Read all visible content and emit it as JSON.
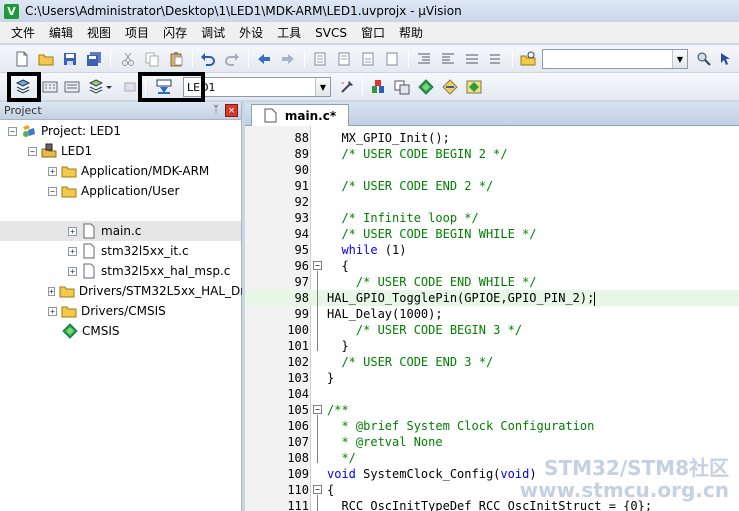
{
  "window": {
    "title": "C:\\Users\\Administrator\\Desktop\\1\\LED1\\MDK-ARM\\LED1.uvprojx - µVision",
    "app_icon": "V"
  },
  "menu": [
    "文件",
    "编辑",
    "视图",
    "项目",
    "闪存",
    "调试",
    "外设",
    "工具",
    "SVCS",
    "窗口",
    "帮助"
  ],
  "toolbar2": {
    "target_combo": "LED1",
    "load_label": "LOAD"
  },
  "project_panel": {
    "title": "Project",
    "pin": "ᛘ",
    "close": "×",
    "tree": [
      {
        "label": "Project: LED1",
        "expander": "−",
        "icon": "project-icon"
      },
      {
        "label": "LED1",
        "expander": "−",
        "icon": "target-icon"
      },
      {
        "label": "Application/MDK-ARM",
        "expander": "+",
        "icon": "folder-icon"
      },
      {
        "label": "Application/User",
        "expander": "−",
        "icon": "folder-icon"
      },
      {
        "label": "main.c",
        "expander": "+",
        "icon": "file-icon"
      },
      {
        "label": "stm32l5xx_it.c",
        "expander": "+",
        "icon": "file-icon"
      },
      {
        "label": "stm32l5xx_hal_msp.c",
        "expander": "+",
        "icon": "file-icon"
      },
      {
        "label": "Drivers/STM32L5xx_HAL_Driver",
        "expander": "+",
        "icon": "folder-icon"
      },
      {
        "label": "Drivers/CMSIS",
        "expander": "+",
        "icon": "folder-icon"
      },
      {
        "label": "CMSIS",
        "expander": "",
        "icon": "cmsis-icon"
      }
    ]
  },
  "editor": {
    "tab_label": "main.c*",
    "lines": [
      {
        "n": "88",
        "parts": [
          [
            "",
            "  MX_GPIO_Init();"
          ]
        ]
      },
      {
        "n": "89",
        "parts": [
          [
            "cm",
            "  /* USER CODE BEGIN 2 */"
          ]
        ]
      },
      {
        "n": "90",
        "parts": [
          [
            "",
            ""
          ]
        ]
      },
      {
        "n": "91",
        "parts": [
          [
            "cm",
            "  /* USER CODE END 2 */"
          ]
        ]
      },
      {
        "n": "92",
        "parts": [
          [
            "",
            ""
          ]
        ]
      },
      {
        "n": "93",
        "parts": [
          [
            "cm",
            "  /* Infinite loop */"
          ]
        ]
      },
      {
        "n": "94",
        "parts": [
          [
            "cm",
            "  /* USER CODE BEGIN WHILE */"
          ]
        ]
      },
      {
        "n": "95",
        "parts": [
          [
            "kw",
            "  while"
          ],
          [
            "",
            " (1)"
          ]
        ]
      },
      {
        "n": "96",
        "parts": [
          [
            "",
            "  {"
          ]
        ],
        "fold": "−"
      },
      {
        "n": "97",
        "parts": [
          [
            "cm",
            "    /* USER CODE END WHILE */"
          ]
        ]
      },
      {
        "n": "98",
        "parts": [
          [
            "",
            "HAL_GPIO_TogglePin(GPIOE,GPIO_PIN_2);"
          ]
        ],
        "current": true
      },
      {
        "n": "99",
        "parts": [
          [
            "",
            "HAL_Delay(1000);"
          ]
        ]
      },
      {
        "n": "100",
        "parts": [
          [
            "cm",
            "    /* USER CODE BEGIN 3 */"
          ]
        ]
      },
      {
        "n": "101",
        "parts": [
          [
            "",
            "  }"
          ]
        ]
      },
      {
        "n": "102",
        "parts": [
          [
            "cm",
            "  /* USER CODE END 3 */"
          ]
        ]
      },
      {
        "n": "103",
        "parts": [
          [
            "",
            "}"
          ]
        ]
      },
      {
        "n": "104",
        "parts": [
          [
            "",
            ""
          ]
        ]
      },
      {
        "n": "105",
        "parts": [
          [
            "cm",
            "/**"
          ]
        ],
        "fold": "−"
      },
      {
        "n": "106",
        "parts": [
          [
            "cm",
            "  * @brief System Clock Configuration"
          ]
        ]
      },
      {
        "n": "107",
        "parts": [
          [
            "cm",
            "  * @retval None"
          ]
        ]
      },
      {
        "n": "108",
        "parts": [
          [
            "cm",
            "  */"
          ]
        ]
      },
      {
        "n": "109",
        "parts": [
          [
            "kw",
            "void"
          ],
          [
            "",
            " SystemClock_Config("
          ],
          [
            "kw",
            "void"
          ],
          [
            "",
            ")"
          ]
        ]
      },
      {
        "n": "110",
        "parts": [
          [
            "",
            "{"
          ]
        ],
        "fold": "−"
      },
      {
        "n": "111",
        "parts": [
          [
            "",
            "  RCC_OscInitTypeDef RCC_OscInitStruct = {0};"
          ]
        ]
      }
    ]
  },
  "watermark": {
    "line1": "STM32/STM8社区",
    "line2": "www.stmcu.org.cn"
  }
}
